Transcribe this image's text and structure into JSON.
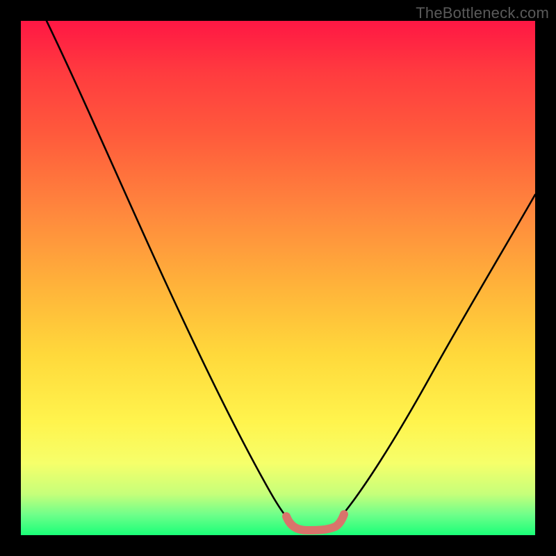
{
  "watermark": "TheBottleneck.com",
  "chart_data": {
    "type": "line",
    "title": "",
    "xlabel": "",
    "ylabel": "",
    "x_range_percent": [
      0,
      100
    ],
    "y_range_percent": [
      0,
      100
    ],
    "series": [
      {
        "name": "bottleneck-curve",
        "color": "#000000",
        "x_percent": [
          5,
          12,
          20,
          28,
          35,
          42,
          48,
          52,
          55,
          58,
          62,
          66,
          70,
          76,
          82,
          88,
          94,
          100
        ],
        "y_percent": [
          100,
          86,
          72,
          58,
          44,
          30,
          16,
          6,
          2,
          2,
          6,
          14,
          24,
          36,
          48,
          58,
          66,
          72
        ]
      },
      {
        "name": "optimal-zone-marker",
        "color": "#d9746b",
        "x_percent": [
          52,
          54,
          56,
          58,
          60,
          62
        ],
        "y_percent": [
          4,
          1,
          1,
          1,
          1,
          4
        ]
      }
    ],
    "background_gradient_stops": [
      {
        "pct": 0,
        "color": "#ff1744"
      },
      {
        "pct": 10,
        "color": "#ff3b3f"
      },
      {
        "pct": 22,
        "color": "#ff5a3c"
      },
      {
        "pct": 38,
        "color": "#ff8a3d"
      },
      {
        "pct": 52,
        "color": "#ffb43a"
      },
      {
        "pct": 65,
        "color": "#ffd93b"
      },
      {
        "pct": 78,
        "color": "#fff44d"
      },
      {
        "pct": 86,
        "color": "#f6ff6a"
      },
      {
        "pct": 92,
        "color": "#c6ff7a"
      },
      {
        "pct": 96,
        "color": "#6fff8a"
      },
      {
        "pct": 100,
        "color": "#1aff78"
      }
    ],
    "grid": false,
    "legend": false
  }
}
